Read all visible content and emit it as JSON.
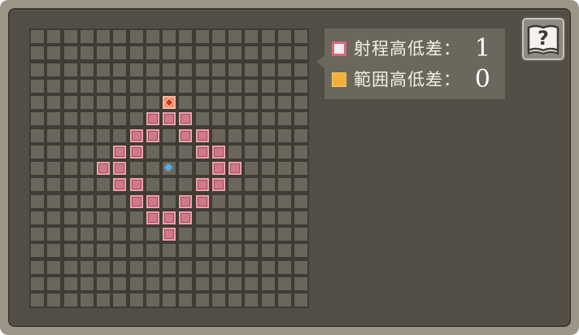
{
  "legend": {
    "range_height": {
      "label": "射程高低差：",
      "value": "1",
      "color": "#d16a7e"
    },
    "area_height": {
      "label": "範囲高低差：",
      "value": "0",
      "color": "#f0b13a"
    }
  },
  "help_button": {
    "icon": "question-book-icon",
    "symbol": "?"
  },
  "grid": {
    "columns": 17,
    "rows": 17,
    "origin": [
      8,
      8
    ],
    "target": [
      8,
      4
    ],
    "range_cells": [
      [
        8,
        4
      ],
      [
        7,
        5
      ],
      [
        8,
        5
      ],
      [
        9,
        5
      ],
      [
        6,
        6
      ],
      [
        7,
        6
      ],
      [
        9,
        6
      ],
      [
        10,
        6
      ],
      [
        5,
        7
      ],
      [
        6,
        7
      ],
      [
        10,
        7
      ],
      [
        11,
        7
      ],
      [
        4,
        8
      ],
      [
        5,
        8
      ],
      [
        11,
        8
      ],
      [
        12,
        8
      ],
      [
        5,
        9
      ],
      [
        6,
        9
      ],
      [
        10,
        9
      ],
      [
        11,
        9
      ],
      [
        6,
        10
      ],
      [
        7,
        10
      ],
      [
        9,
        10
      ],
      [
        10,
        10
      ],
      [
        7,
        11
      ],
      [
        8,
        11
      ],
      [
        9,
        11
      ],
      [
        8,
        12
      ]
    ],
    "colors": {
      "cell": "#6b665b",
      "range": "#d07a88",
      "target": "#f28a66",
      "origin": "#43b7ff"
    }
  }
}
